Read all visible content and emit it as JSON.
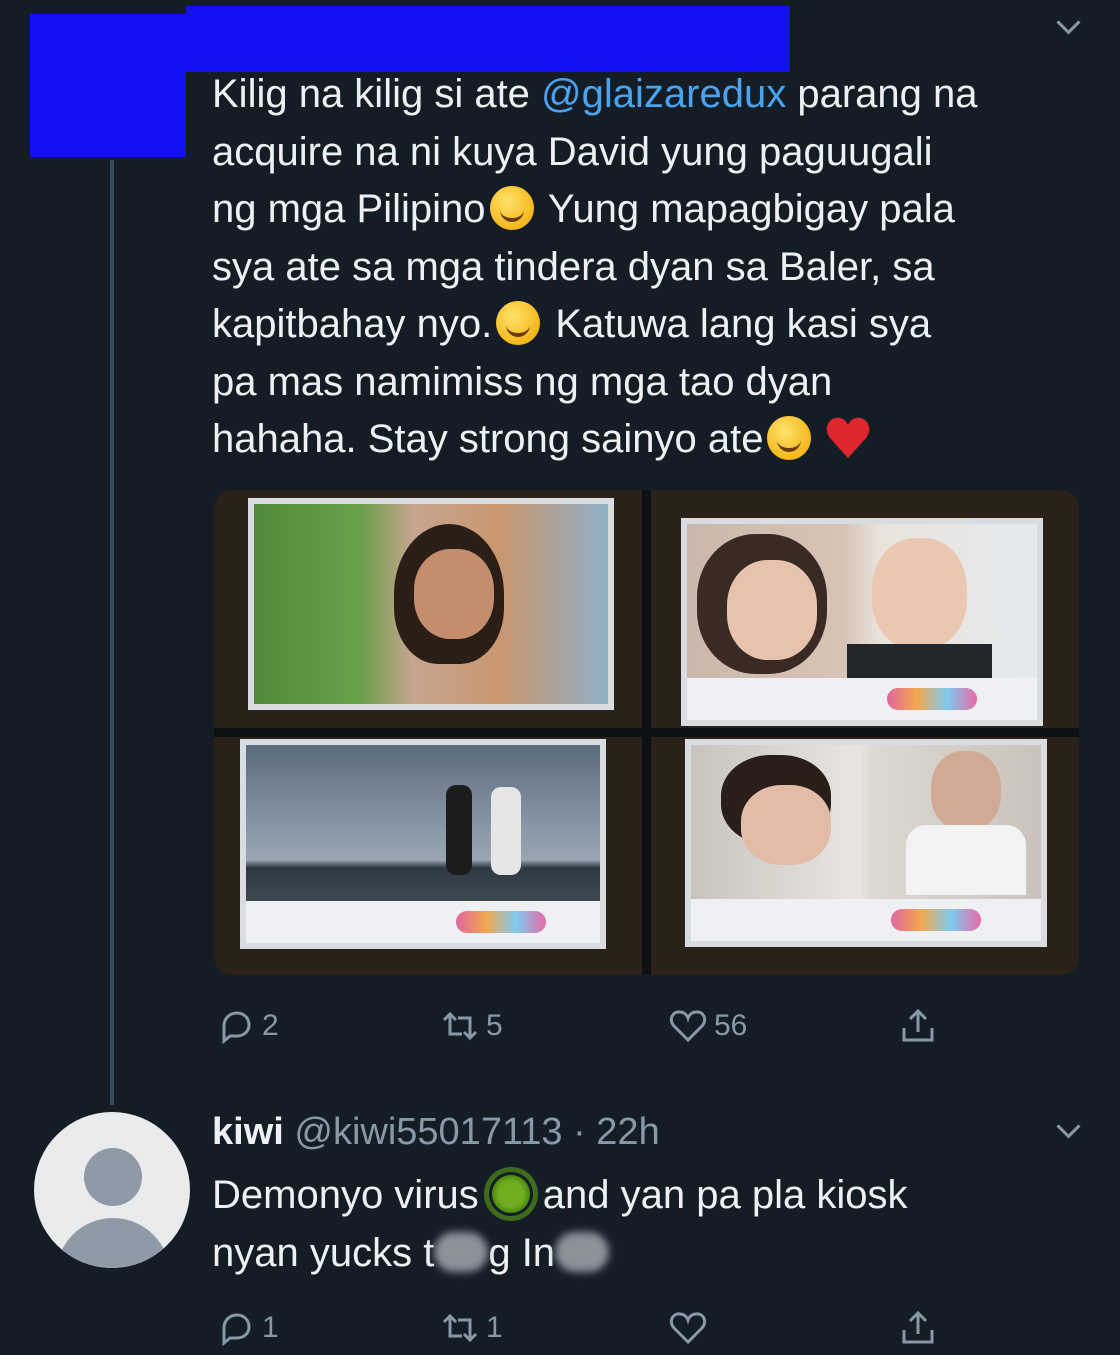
{
  "tweet": {
    "text_lines": [
      "Kilig na kilig si ate ",
      "@glaizaredux",
      " parang na",
      "acquire na ni kuya David yung paguugali",
      "ng mga Pilipino",
      " Yung mapagbigay pala",
      "sya ate sa mga tindera dyan sa Baler, sa",
      "kapitbahay nyo.",
      " Katuwa lang kasi sya",
      "pa mas namimiss ng mga tao dyan",
      "hahaha. Stay strong sainyo ate"
    ],
    "actions": {
      "reply_count": "2",
      "retweet_count": "5",
      "like_count": "56"
    }
  },
  "reply": {
    "name": "kiwi",
    "handle": "@kiwi55017113",
    "time": " · 22h",
    "text_line1_a": "Demonyo virus",
    "text_line1_b": "and yan pa pla kiosk",
    "text_line2_a": "nyan yucks t",
    "text_line2_b": "g In",
    "actions": {
      "reply_count": "1",
      "retweet_count": "1",
      "like_count": ""
    }
  },
  "icons": [
    "chevron-down-icon",
    "reply-icon",
    "retweet-icon",
    "like-icon",
    "share-icon",
    "smile-emoji-icon",
    "heart-emoji-icon",
    "virus-emoji-icon",
    "default-avatar-icon"
  ],
  "colors": {
    "background": "#141d26",
    "mention": "#4aa3ef",
    "muted": "#8899a6",
    "redaction": "#1010f0"
  }
}
